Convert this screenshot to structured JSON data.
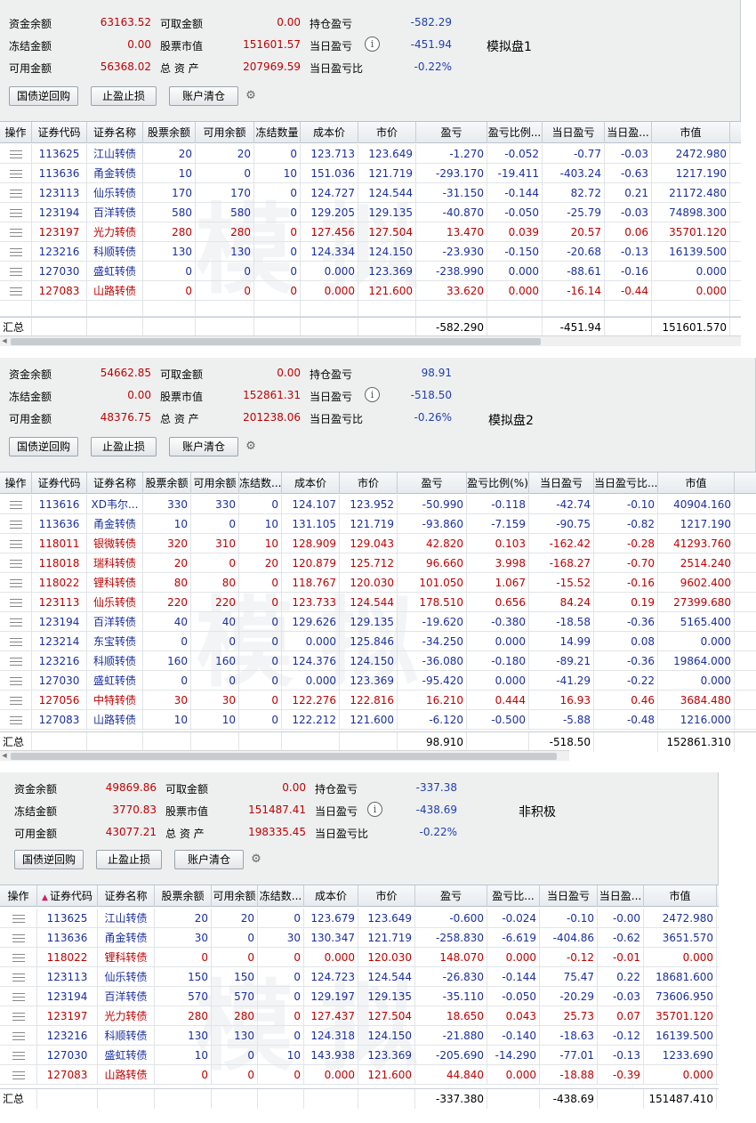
{
  "labels": {
    "fund_balance": "资金余额",
    "withdrawable": "可取金额",
    "position_pnl": "持仓盈亏",
    "frozen": "冻结金额",
    "stock_value": "股票市值",
    "day_pnl": "当日盈亏",
    "available": "可用金额",
    "total_assets": "总 资 产",
    "day_pnl_ratio": "当日盈亏比",
    "info_icon": "i",
    "total": "汇总"
  },
  "buttons": {
    "repo": "国债逆回购",
    "stop": "止盈止损",
    "clear": "账户清仓"
  },
  "colors": {
    "red": "#c00000",
    "blue": "#1f3fb0",
    "panel_bg": "#eef0f0"
  },
  "icons": [
    "info-icon",
    "gear-icon",
    "menu-icon"
  ],
  "panels": [
    {
      "name": "模拟盘1",
      "summary": {
        "fund_balance": "63163.52",
        "withdrawable": "0.00",
        "position_pnl": "-582.29",
        "frozen": "0.00",
        "stock_value": "151601.57",
        "day_pnl": "-451.94",
        "available": "56368.02",
        "total_assets": "207969.59",
        "day_pnl_ratio": "-0.22%"
      },
      "headers": [
        "操作",
        "证券代码",
        "证券名称",
        "股票余额",
        "可用余额",
        "冻结数量",
        "成本价",
        "市价",
        "盈亏",
        "盈亏比例...",
        "当日盈亏",
        "当日盈...",
        "市值"
      ],
      "rows": [
        [
          "113625",
          "江山转债",
          "20",
          "20",
          "0",
          "123.713",
          "123.649",
          "-1.270",
          "-0.052",
          "-0.77",
          "-0.03",
          "2472.980"
        ],
        [
          "113636",
          "甬金转债",
          "10",
          "0",
          "10",
          "151.036",
          "121.719",
          "-293.170",
          "-19.411",
          "-403.24",
          "-0.63",
          "1217.190"
        ],
        [
          "123113",
          "仙乐转债",
          "170",
          "170",
          "0",
          "124.727",
          "124.544",
          "-31.150",
          "-0.144",
          "82.72",
          "0.21",
          "21172.480"
        ],
        [
          "123194",
          "百洋转债",
          "580",
          "580",
          "0",
          "129.205",
          "129.135",
          "-40.870",
          "-0.050",
          "-25.79",
          "-0.03",
          "74898.300"
        ],
        [
          "123197",
          "光力转债",
          "280",
          "280",
          "0",
          "127.456",
          "127.504",
          "13.470",
          "0.039",
          "20.57",
          "0.06",
          "35701.120"
        ],
        [
          "123216",
          "科顺转债",
          "130",
          "130",
          "0",
          "124.334",
          "124.150",
          "-23.930",
          "-0.150",
          "-20.68",
          "-0.13",
          "16139.500"
        ],
        [
          "127030",
          "盛虹转债",
          "0",
          "0",
          "0",
          "0.000",
          "123.369",
          "-238.990",
          "0.000",
          "-88.61",
          "-0.16",
          "0.000"
        ],
        [
          "127083",
          "山路转债",
          "0",
          "0",
          "0",
          "0.000",
          "121.600",
          "33.620",
          "0.000",
          "-16.14",
          "-0.44",
          "0.000"
        ]
      ],
      "row_colors": [
        "blue",
        "blue",
        "blue",
        "blue",
        "red",
        "blue",
        "blue",
        "red"
      ],
      "totals": {
        "pnl": "-582.290",
        "day_pnl": "-451.94",
        "market_value": "151601.570"
      }
    },
    {
      "name": "模拟盘2",
      "summary": {
        "fund_balance": "54662.85",
        "withdrawable": "0.00",
        "position_pnl": "98.91",
        "frozen": "0.00",
        "stock_value": "152861.31",
        "day_pnl": "-518.50",
        "available": "48376.75",
        "total_assets": "201238.06",
        "day_pnl_ratio": "-0.26%"
      },
      "headers": [
        "操作",
        "证券代码",
        "证券名称",
        "股票余额",
        "可用余额",
        "冻结数...",
        "成本价",
        "市价",
        "盈亏",
        "盈亏比例(%)",
        "当日盈亏",
        "当日盈亏比...",
        "市值"
      ],
      "rows": [
        [
          "113616",
          "XD韦尔...",
          "330",
          "330",
          "0",
          "124.107",
          "123.952",
          "-50.990",
          "-0.118",
          "-42.74",
          "-0.10",
          "40904.160"
        ],
        [
          "113636",
          "甬金转债",
          "10",
          "0",
          "10",
          "131.105",
          "121.719",
          "-93.860",
          "-7.159",
          "-90.75",
          "-0.82",
          "1217.190"
        ],
        [
          "118011",
          "银微转债",
          "320",
          "310",
          "10",
          "128.909",
          "129.043",
          "42.820",
          "0.103",
          "-162.42",
          "-0.28",
          "41293.760"
        ],
        [
          "118018",
          "瑞科转债",
          "20",
          "0",
          "20",
          "120.879",
          "125.712",
          "96.660",
          "3.998",
          "-168.27",
          "-0.70",
          "2514.240"
        ],
        [
          "118022",
          "锂科转债",
          "80",
          "80",
          "0",
          "118.767",
          "120.030",
          "101.050",
          "1.067",
          "-15.52",
          "-0.16",
          "9602.400"
        ],
        [
          "123113",
          "仙乐转债",
          "220",
          "220",
          "0",
          "123.733",
          "124.544",
          "178.510",
          "0.656",
          "84.24",
          "0.19",
          "27399.680"
        ],
        [
          "123194",
          "百洋转债",
          "40",
          "40",
          "0",
          "129.626",
          "129.135",
          "-19.620",
          "-0.380",
          "-18.58",
          "-0.36",
          "5165.400"
        ],
        [
          "123214",
          "东宝转债",
          "0",
          "0",
          "0",
          "0.000",
          "125.846",
          "-34.250",
          "0.000",
          "14.99",
          "0.08",
          "0.000"
        ],
        [
          "123216",
          "科顺转债",
          "160",
          "160",
          "0",
          "124.376",
          "124.150",
          "-36.080",
          "-0.180",
          "-89.21",
          "-0.36",
          "19864.000"
        ],
        [
          "127030",
          "盛虹转债",
          "0",
          "0",
          "0",
          "0.000",
          "123.369",
          "-95.420",
          "0.000",
          "-41.29",
          "-0.22",
          "0.000"
        ],
        [
          "127056",
          "中特转债",
          "30",
          "30",
          "0",
          "122.276",
          "122.816",
          "16.210",
          "0.444",
          "16.93",
          "0.46",
          "3684.480"
        ],
        [
          "127083",
          "山路转债",
          "10",
          "10",
          "0",
          "122.212",
          "121.600",
          "-6.120",
          "-0.500",
          "-5.88",
          "-0.48",
          "1216.000"
        ]
      ],
      "row_colors": [
        "blue",
        "blue",
        "red",
        "red",
        "red",
        "red",
        "blue",
        "blue",
        "blue",
        "blue",
        "red",
        "blue"
      ],
      "totals": {
        "pnl": "98.910",
        "day_pnl": "-518.50",
        "market_value": "152861.310"
      }
    },
    {
      "name": "非积极",
      "summary": {
        "fund_balance": "49869.86",
        "withdrawable": "0.00",
        "position_pnl": "-337.38",
        "frozen": "3770.83",
        "stock_value": "151487.41",
        "day_pnl": "-438.69",
        "available": "43077.21",
        "total_assets": "198335.45",
        "day_pnl_ratio": "-0.22%"
      },
      "headers": [
        "操作",
        "证券代码",
        "证券名称",
        "股票余额",
        "可用余额",
        "冻结数...",
        "成本价",
        "市价",
        "盈亏",
        "盈亏比...",
        "当日盈亏",
        "当日盈...",
        "市值"
      ],
      "rows": [
        [
          "113625",
          "江山转债",
          "20",
          "20",
          "0",
          "123.679",
          "123.649",
          "-0.600",
          "-0.024",
          "-0.10",
          "-0.00",
          "2472.980"
        ],
        [
          "113636",
          "甬金转债",
          "30",
          "0",
          "30",
          "130.347",
          "121.719",
          "-258.830",
          "-6.619",
          "-404.86",
          "-0.62",
          "3651.570"
        ],
        [
          "118022",
          "锂科转债",
          "0",
          "0",
          "0",
          "0.000",
          "120.030",
          "148.070",
          "0.000",
          "-0.12",
          "-0.01",
          "0.000"
        ],
        [
          "123113",
          "仙乐转债",
          "150",
          "150",
          "0",
          "124.723",
          "124.544",
          "-26.830",
          "-0.144",
          "75.47",
          "0.22",
          "18681.600"
        ],
        [
          "123194",
          "百洋转债",
          "570",
          "570",
          "0",
          "129.197",
          "129.135",
          "-35.110",
          "-0.050",
          "-20.29",
          "-0.03",
          "73606.950"
        ],
        [
          "123197",
          "光力转债",
          "280",
          "280",
          "0",
          "127.437",
          "127.504",
          "18.650",
          "0.043",
          "25.73",
          "0.07",
          "35701.120"
        ],
        [
          "123216",
          "科顺转债",
          "130",
          "130",
          "0",
          "124.318",
          "124.150",
          "-21.880",
          "-0.140",
          "-18.63",
          "-0.12",
          "16139.500"
        ],
        [
          "127030",
          "盛虹转债",
          "10",
          "0",
          "10",
          "143.938",
          "123.369",
          "-205.690",
          "-14.290",
          "-77.01",
          "-0.13",
          "1233.690"
        ],
        [
          "127083",
          "山路转债",
          "0",
          "0",
          "0",
          "0.000",
          "121.600",
          "44.840",
          "0.000",
          "-18.88",
          "-0.39",
          "0.000"
        ]
      ],
      "row_colors": [
        "blue",
        "blue",
        "red",
        "blue",
        "blue",
        "red",
        "blue",
        "blue",
        "red"
      ],
      "totals": {
        "pnl": "-337.380",
        "day_pnl": "-438.69",
        "market_value": "151487.410"
      }
    }
  ]
}
